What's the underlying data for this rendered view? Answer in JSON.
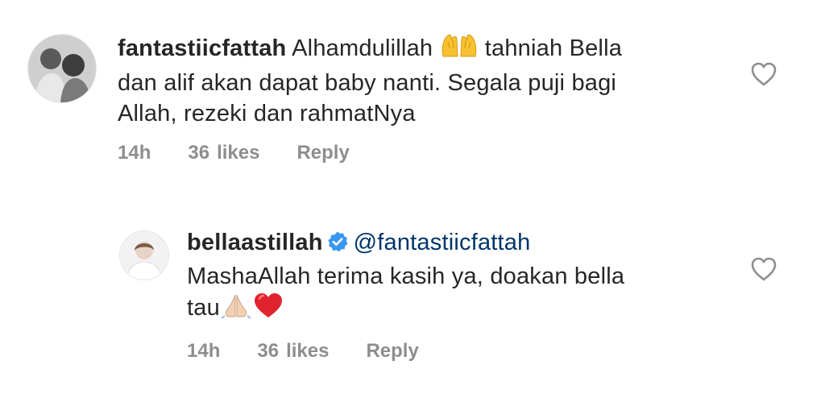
{
  "comments": [
    {
      "username": "fantastiicfattah",
      "text_1": "Alhamdulillah",
      "emoji_1": "raising-hands-emoji",
      "text_2": "tahniah Bella",
      "line_2": "dan alif akan dapat baby nanti. Segala puji bagi",
      "line_3": "Allah, rezeki dan rahmatNya",
      "time": "14h",
      "likes_count": "36",
      "likes_word": "likes",
      "reply_label": "Reply"
    },
    {
      "username": "bellaastillah",
      "verified": true,
      "mention": "@fantastiicfattah",
      "line_2": "MashaAllah terima kasih ya, doakan bella",
      "line_3": "tau",
      "emoji_1": "folded-hands-emoji",
      "emoji_2": "red-heart-emoji",
      "time": "14h",
      "likes_count": "36",
      "likes_word": "likes",
      "reply_label": "Reply"
    }
  ],
  "colors": {
    "text": "#262626",
    "meta": "#8e8e8e",
    "mention": "#003569",
    "verified": "#3897f0",
    "heart": "#8e8e8e"
  }
}
